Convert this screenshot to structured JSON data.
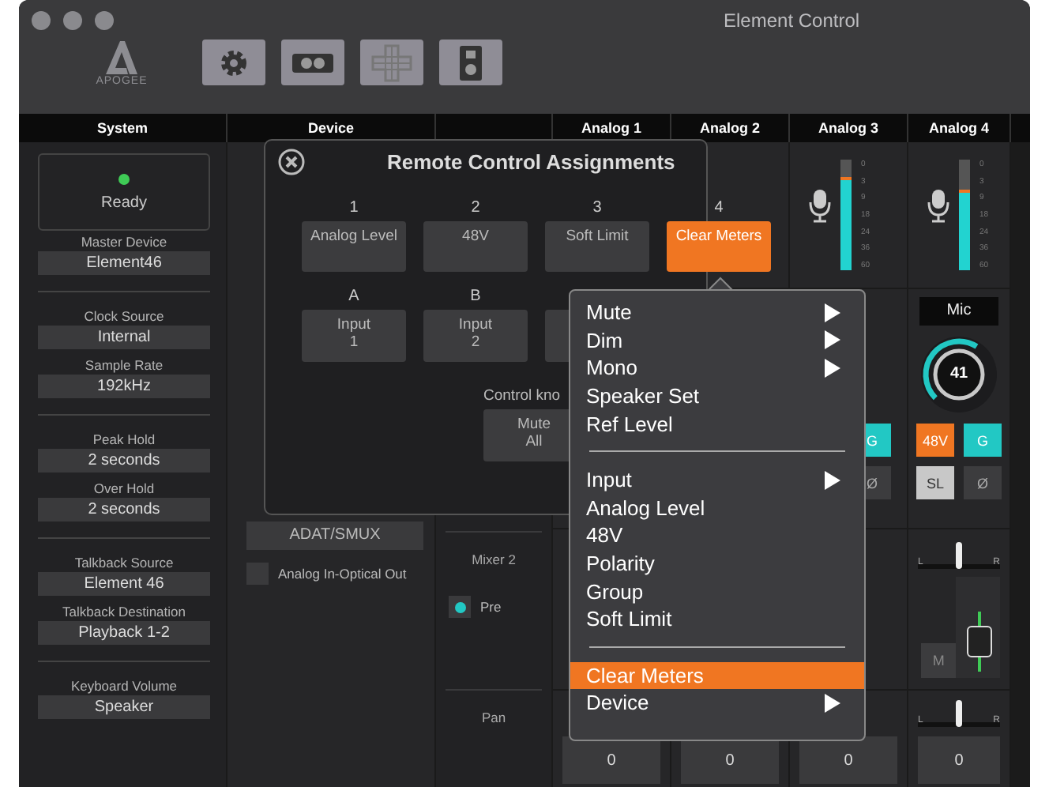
{
  "window": {
    "title": "Element Control"
  },
  "logo": "APOGEE",
  "headers": [
    {
      "label": "System"
    },
    {
      "label": "Device"
    },
    {
      "label": "Analog 1"
    },
    {
      "label": "Analog 2"
    },
    {
      "label": "Analog 3"
    },
    {
      "label": "Analog 4"
    }
  ],
  "system": {
    "status": "Ready",
    "groups": [
      [
        {
          "label": "Master Device",
          "value": "Element46"
        }
      ],
      [
        {
          "label": "Clock Source",
          "value": "Internal"
        },
        {
          "label": "Sample Rate",
          "value": "192kHz"
        }
      ],
      [
        {
          "label": "Peak Hold",
          "value": "2 seconds"
        },
        {
          "label": "Over Hold",
          "value": "2 seconds"
        }
      ],
      [
        {
          "label": "Talkback Source",
          "value": "Element 46"
        },
        {
          "label": "Talkback Destination",
          "value": "Playback 1-2"
        }
      ],
      [
        {
          "label": "Keyboard Volume",
          "value": "Speaker"
        }
      ]
    ]
  },
  "device": {
    "mode": "ADAT/SMUX",
    "options": [
      {
        "label": "Analog In-Optical Out",
        "selected": false
      }
    ]
  },
  "mixer": {
    "title": "Mixer 2",
    "options": [
      {
        "label": "Pre",
        "selected": true
      }
    ],
    "pan_label": "Pan"
  },
  "strips": [
    {
      "value": "0"
    },
    {
      "value": "0"
    },
    {
      "meter": {
        "level": 0.82,
        "scale": [
          "0",
          "3",
          "9",
          "18",
          "24",
          "36",
          "60"
        ]
      },
      "buttons": [
        {
          "kind": "group",
          "label": "G",
          "on": true
        },
        {
          "kind": "polarity",
          "label": "Ø",
          "on": false
        }
      ],
      "value": "0"
    },
    {
      "meter": {
        "level": 0.7,
        "scale": [
          "0",
          "3",
          "9",
          "18",
          "24",
          "36",
          "60"
        ]
      },
      "input": "Mic",
      "knob": {
        "label": "41",
        "level": 0.62
      },
      "buttons": [
        {
          "kind": "phantom",
          "label": "48V",
          "on": true
        },
        {
          "kind": "group",
          "label": "G",
          "on": true
        },
        {
          "kind": "limit",
          "label": "SL",
          "on": true
        },
        {
          "kind": "polarity",
          "label": "Ø",
          "on": false
        }
      ],
      "pan": {
        "level": 0.5,
        "labels": [
          "L",
          "R"
        ]
      },
      "fader": {
        "level": 0.35
      },
      "mute": "M",
      "pan2": {
        "level": 0.5,
        "labels": [
          "L",
          "R"
        ]
      },
      "value": "0"
    }
  ],
  "dialog": {
    "title": "Remote Control Assignments",
    "assignments": [
      {
        "number": "1",
        "label": "Analog Level",
        "selected": false
      },
      {
        "number": "2",
        "label": "48V",
        "selected": false
      },
      {
        "number": "3",
        "label": "Soft Limit",
        "selected": false
      },
      {
        "number": "4",
        "label": "Clear Meters",
        "selected": true
      }
    ],
    "inputs": [
      {
        "letter": "A",
        "lines": [
          "Input",
          "1"
        ]
      },
      {
        "letter": "B",
        "lines": [
          "Input",
          "2"
        ]
      }
    ],
    "knob_label": "Control kno",
    "knob_buttons": [
      {
        "lines": [
          "Mute",
          "All"
        ]
      }
    ]
  },
  "menu": {
    "items": [
      {
        "kind": "item",
        "label": "Mute",
        "submenu": true,
        "selected": false
      },
      {
        "kind": "item",
        "label": "Dim",
        "submenu": true,
        "selected": false
      },
      {
        "kind": "item",
        "label": "Mono",
        "submenu": true,
        "selected": false
      },
      {
        "kind": "item",
        "label": "Speaker Set",
        "submenu": false,
        "selected": false
      },
      {
        "kind": "item",
        "label": "Ref Level",
        "submenu": false,
        "selected": false
      },
      {
        "kind": "separator"
      },
      {
        "kind": "item",
        "label": "Input",
        "submenu": true,
        "selected": false
      },
      {
        "kind": "item",
        "label": "Analog Level",
        "submenu": false,
        "selected": false
      },
      {
        "kind": "item",
        "label": "48V",
        "submenu": false,
        "selected": false
      },
      {
        "kind": "item",
        "label": "Polarity",
        "submenu": false,
        "selected": false
      },
      {
        "kind": "item",
        "label": "Group",
        "submenu": false,
        "selected": false
      },
      {
        "kind": "item",
        "label": "Soft Limit",
        "submenu": false,
        "selected": false
      },
      {
        "kind": "separator"
      },
      {
        "kind": "item",
        "label": "Clear Meters",
        "submenu": false,
        "selected": true
      },
      {
        "kind": "item",
        "label": "Device",
        "submenu": true,
        "selected": false
      }
    ]
  }
}
